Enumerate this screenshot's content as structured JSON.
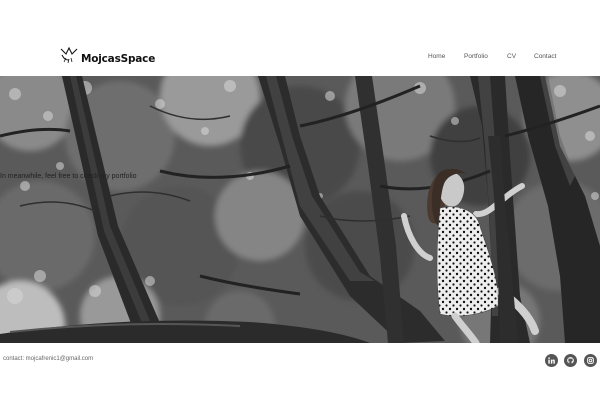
{
  "header": {
    "logo_text": "MojcasSpace",
    "nav": [
      {
        "label": "Home"
      },
      {
        "label": "Portfolio"
      },
      {
        "label": "CV"
      },
      {
        "label": "Contact"
      }
    ]
  },
  "hero": {
    "tagline": "In meanwhile, feel free to check my portfolio"
  },
  "footer": {
    "contact": "contact: mojcafrenic1@gmail.com",
    "social_icons": [
      "linkedin-icon",
      "github-icon",
      "instagram-icon"
    ]
  },
  "colors": {
    "background": "#ffffff",
    "hero_tone": "#3a3a3a",
    "social_icon": "#555555"
  }
}
